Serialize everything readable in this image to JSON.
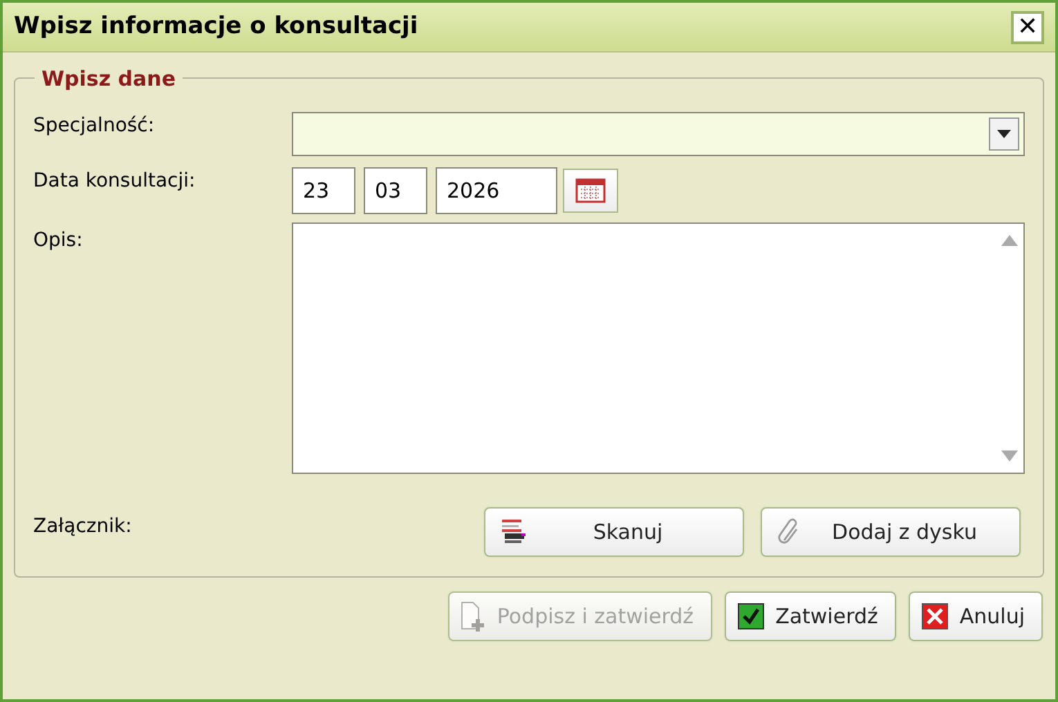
{
  "window": {
    "title": "Wpisz informacje o konsultacji",
    "close": "✕"
  },
  "group": {
    "legend": "Wpisz dane"
  },
  "specialty": {
    "label": "Specjalność:"
  },
  "date": {
    "label": "Data konsultacji:",
    "day": "23",
    "month": "03",
    "year": "2026"
  },
  "description": {
    "label": "Opis:"
  },
  "attachment": {
    "label": "Załącznik:",
    "buttons": [
      {
        "label": "Skanuj",
        "kind": "scan"
      },
      {
        "label": "Dodaj z dysku",
        "kind": "clip"
      }
    ]
  },
  "buttons": [
    {
      "label": "Podpisz i zatwierdź",
      "kind": "sign",
      "disabled": true
    },
    {
      "label": "Zatwierdź",
      "kind": "ok",
      "disabled": false
    },
    {
      "label": "Anuluj",
      "kind": "cancel",
      "disabled": false
    }
  ]
}
